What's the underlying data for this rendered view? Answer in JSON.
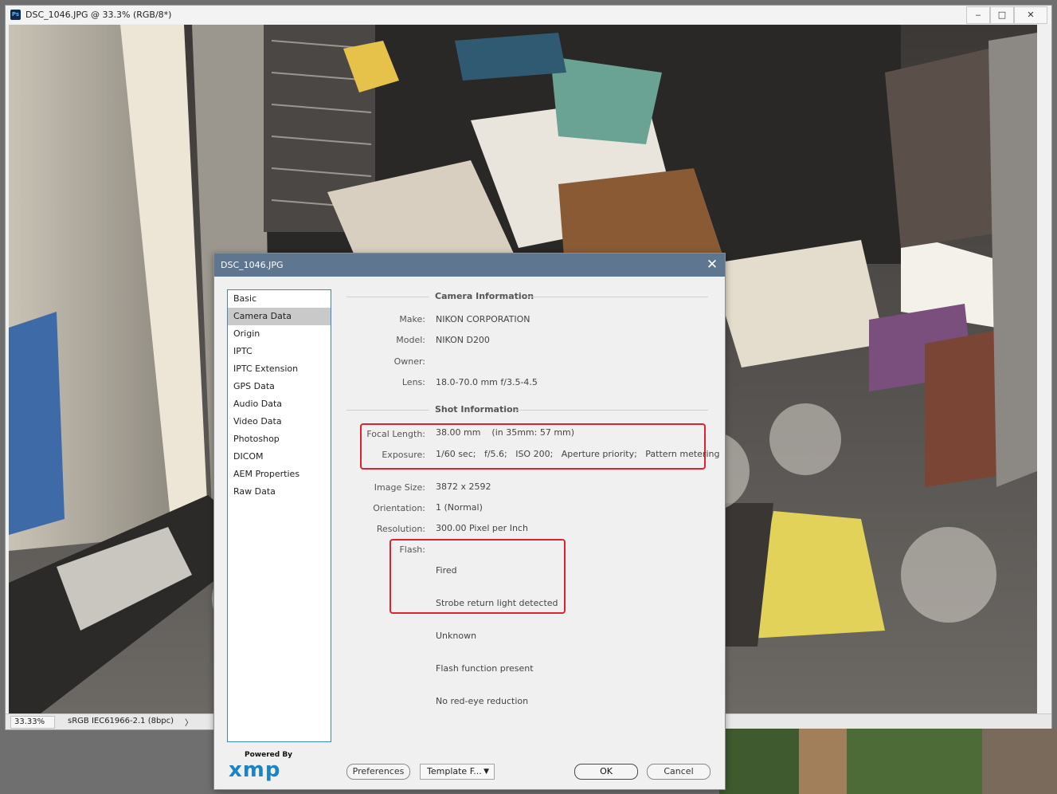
{
  "photoshop": {
    "title": "DSC_1046.JPG @ 33.3% (RGB/8*)",
    "logo": "Ps",
    "minimize": "‒",
    "maximize": "□",
    "close": "✕",
    "zoom": "33.33%",
    "profile": "sRGB IEC61966-2.1 (8bpc)",
    "status_arrow": "〉"
  },
  "dialog": {
    "title": "DSC_1046.JPG",
    "close": "✕",
    "categories": [
      "Basic",
      "Camera Data",
      "Origin",
      "IPTC",
      "IPTC Extension",
      "GPS Data",
      "Audio Data",
      "Video Data",
      "Photoshop",
      "DICOM",
      "AEM Properties",
      "Raw Data"
    ],
    "active_category": "Camera Data",
    "camera_section": "Camera Information",
    "make_label": "Make:",
    "make": "NIKON CORPORATION",
    "model_label": "Model:",
    "model": "NIKON D200",
    "owner_label": "Owner:",
    "owner": "",
    "lens_label": "Lens:",
    "lens": "18.0-70.0 mm f/3.5-4.5",
    "shot_section": "Shot Information",
    "focal_label": "Focal Length:",
    "focal": "38.00 mm    (in 35mm: 57 mm)",
    "exposure_label": "Exposure:",
    "exposure": "1/60 sec;   f/5.6;   ISO 200;   Aperture priority;   Pattern metering",
    "image_size_label": "Image Size:",
    "image_size": "3872 x 2592",
    "orientation_label": "Orientation:",
    "orientation": "1 (Normal)",
    "resolution_label": "Resolution:",
    "resolution": "300.00 Pixel per Inch",
    "flash_label": "Flash:",
    "flash": [
      "Fired",
      "Strobe return light detected",
      "Unknown",
      "Flash function present",
      "No red-eye reduction"
    ],
    "powered_by": "Powered By",
    "xmp": "xmp",
    "preferences": "Preferences",
    "template": "Template F...",
    "ok": "OK",
    "cancel": "Cancel",
    "highlight_color": "#e0222e",
    "titlebar_color": "#5e768f"
  }
}
